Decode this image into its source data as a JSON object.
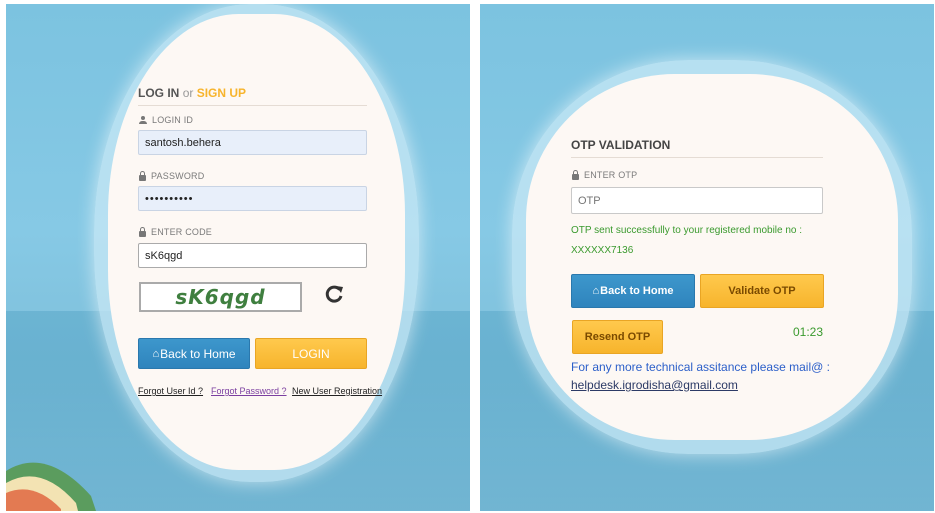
{
  "login": {
    "title_log_in": "LOG IN",
    "title_or": "or",
    "title_sign_up": "SIGN UP",
    "login_id_label": "LOGIN ID",
    "login_id_value": "santosh.behera",
    "password_label": "PASSWORD",
    "password_value": "••••••••••",
    "code_label": "ENTER CODE",
    "code_value": "sK6qgd",
    "captcha_text": "sK6qgd",
    "back_home_label": "Back to Home",
    "login_label": "LOGIN",
    "forgot_user_id": "Forgot User Id ?",
    "forgot_password": "Forgot Password ?",
    "new_user_registration": "New User Registration"
  },
  "otp": {
    "title": "OTP VALIDATION",
    "enter_otp_label": "ENTER OTP",
    "otp_placeholder": "OTP",
    "sent_message": "OTP sent successfully to your registered mobile no :",
    "mobile_masked": "XXXXXX7136",
    "back_home_label": "Back to Home",
    "validate_label": "Validate OTP",
    "resend_label": "Resend OTP",
    "timer": "01:23",
    "help_text": "For any more technical assitance please mail@ :",
    "help_email": "helpdesk.igrodisha@gmail.com"
  },
  "colors": {
    "accent_orange": "#f7b42c",
    "primary_blue": "#2f84bd",
    "success_green": "#3a9a2e",
    "link_purple": "#7b3fa0",
    "help_blue": "#2c5fc9"
  },
  "icons": [
    "user-icon",
    "lock-icon",
    "refresh-icon",
    "home-icon"
  ]
}
